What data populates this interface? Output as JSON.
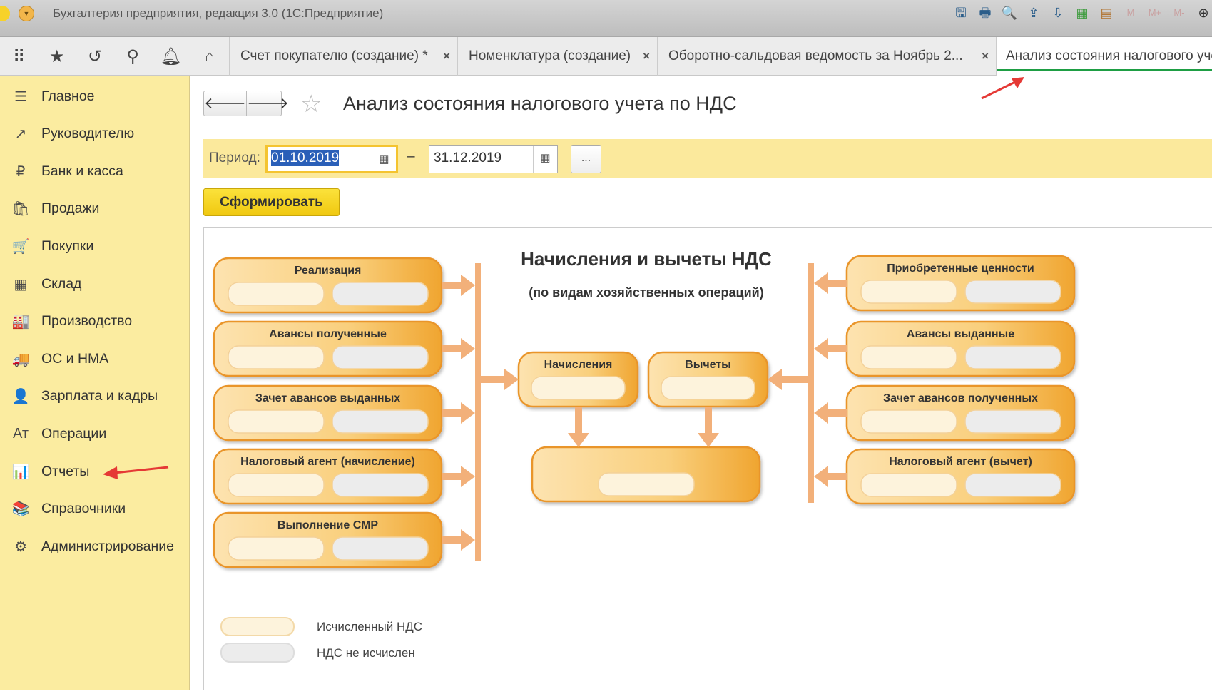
{
  "window": {
    "title": "Бухгалтерия предприятия, редакция 3.0  (1С:Предприятие)",
    "logo": "1С",
    "toolbar_icons": [
      "save-icon",
      "print-icon",
      "preview-icon",
      "export-icon",
      "import-icon",
      "calculator-icon",
      "calendar-icon",
      "M",
      "M+",
      "M-",
      "zoom-icon"
    ]
  },
  "quick_icons": [
    "apps-grid-icon",
    "star-icon",
    "history-icon",
    "search-icon",
    "bell-icon"
  ],
  "tabs": [
    {
      "label": "Счет покупателю (создание) *",
      "closable": true
    },
    {
      "label": "Номенклатура (создание)",
      "closable": true
    },
    {
      "label": "Оборотно-сальдовая ведомость за Ноябрь 2...",
      "closable": true
    },
    {
      "label": "Анализ состояния налогового учета по НДС",
      "active": true
    }
  ],
  "tab_close": "×",
  "sidebar": {
    "items": [
      {
        "label": "Главное",
        "icon": "☰"
      },
      {
        "label": "Руководителю",
        "icon": "↗"
      },
      {
        "label": "Банк и касса",
        "icon": "₽"
      },
      {
        "label": "Продажи",
        "icon": "🛍"
      },
      {
        "label": "Покупки",
        "icon": "🛒"
      },
      {
        "label": "Склад",
        "icon": "▦"
      },
      {
        "label": "Производство",
        "icon": "🏭"
      },
      {
        "label": "ОС и НМА",
        "icon": "🚚"
      },
      {
        "label": "Зарплата и кадры",
        "icon": "👤"
      },
      {
        "label": "Операции",
        "icon": "Ат"
      },
      {
        "label": "Отчеты",
        "icon": "📊"
      },
      {
        "label": "Справочники",
        "icon": "📚"
      },
      {
        "label": "Администрирование",
        "icon": "⚙"
      }
    ]
  },
  "form": {
    "title": "Анализ состояния налогового учета по НДС",
    "back": "🡐",
    "forward": "🡒",
    "period_label": "Период:",
    "date_from": "01.10.2019",
    "date_to": "31.12.2019",
    "dash": "–",
    "more": "...",
    "generate": "Сформировать"
  },
  "diagram": {
    "title": "Начисления и вычеты НДС",
    "subtitle": "(по видам хозяйственных операций)",
    "left": [
      "Реализация",
      "Авансы полученные",
      "Зачет авансов выданных",
      "Налоговый агент (начисление)",
      "Выполнение СМР"
    ],
    "right": [
      "Приобретенные ценности",
      "Авансы выданные",
      "Зачет авансов полученных",
      "Налоговый агент (вычет)"
    ],
    "middle": [
      "Начисления",
      "Вычеты"
    ],
    "colors": {
      "box": "#f4b447",
      "calculated": "#fdf3dc",
      "not_calculated": "#ececec",
      "arrow": "#f2b07a"
    }
  },
  "legend": [
    {
      "label": "Исчисленный НДС",
      "color": "#fdf3dc"
    },
    {
      "label": "НДС не исчислен",
      "color": "#ececec"
    }
  ]
}
